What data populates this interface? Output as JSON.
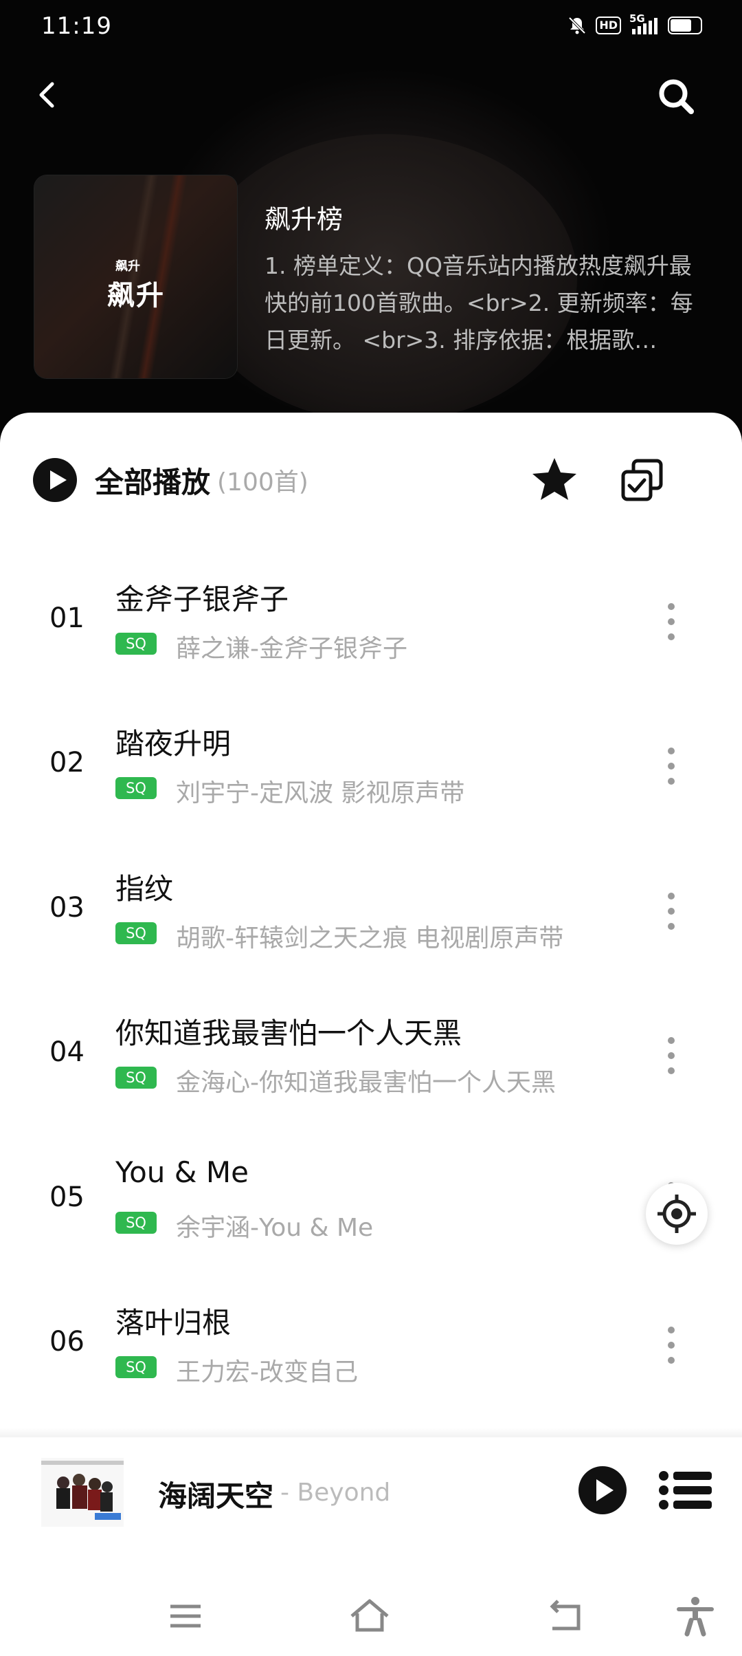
{
  "status_bar": {
    "time": "11:19",
    "hd_badge": "HD",
    "network": "5G",
    "battery_level": 0.72
  },
  "header": {
    "cover_small_text": "飙升",
    "cover_big_text": "飙升",
    "board_title": "飙升榜",
    "board_description": "1. 榜单定义：QQ音乐站内播放热度飙升最快的前100首歌曲。<br>2. 更新频率：每日更新。 <br>3. 排序依据：根据歌…"
  },
  "toolbar": {
    "play_all_label": "全部播放",
    "count_label": "(100首)"
  },
  "songs": [
    {
      "rank": "01",
      "title": "金斧子银斧子",
      "quality": "SQ",
      "artist_album": "薛之谦-金斧子银斧子"
    },
    {
      "rank": "02",
      "title": "踏夜升明",
      "quality": "SQ",
      "artist_album": "刘宇宁-定风波 影视原声带"
    },
    {
      "rank": "03",
      "title": "指纹",
      "quality": "SQ",
      "artist_album": "胡歌-轩辕剑之天之痕 电视剧原声带"
    },
    {
      "rank": "04",
      "title": "你知道我最害怕一个人天黑",
      "quality": "SQ",
      "artist_album": "金海心-你知道我最害怕一个人天黑"
    },
    {
      "rank": "05",
      "title": "You & Me",
      "quality": "SQ",
      "artist_album": "余宇涵-You & Me"
    },
    {
      "rank": "06",
      "title": "落叶归根",
      "quality": "SQ",
      "artist_album": "王力宏-改变自己"
    }
  ],
  "mini_player": {
    "song": "海阔天空",
    "artist": "- Beyond"
  },
  "icons": {
    "back": "chevron-left-icon",
    "search": "search-icon",
    "star": "star-icon",
    "multi_select": "multi-select-icon",
    "more": "more-vertical-icon",
    "locate": "locate-icon",
    "playlist": "playlist-icon",
    "nav_menu": "menu-icon",
    "nav_home": "home-icon",
    "nav_back": "back-icon",
    "nav_accessibility": "accessibility-icon"
  },
  "colors": {
    "sq_badge": "#2fb84f",
    "header_bg": "#000000",
    "secondary_text": "#a9a9a9"
  }
}
